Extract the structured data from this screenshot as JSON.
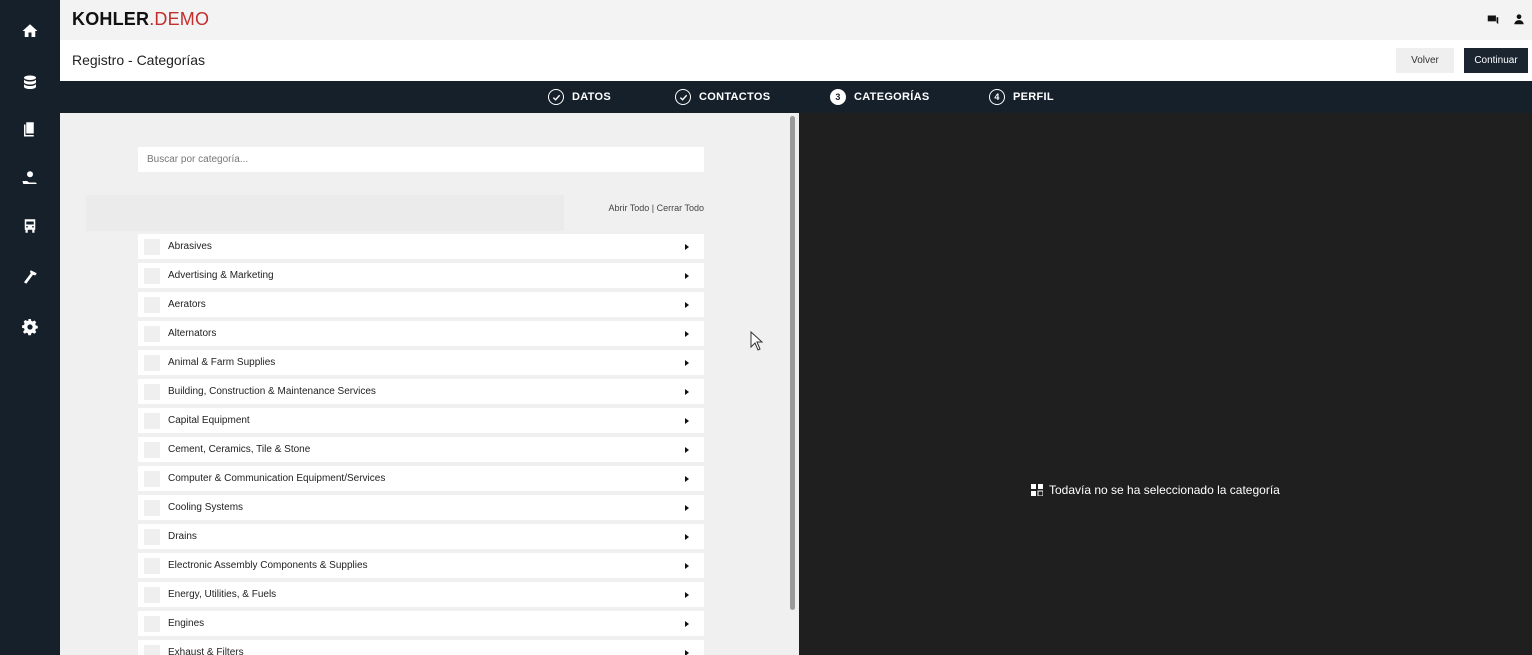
{
  "brand": {
    "name": "KOHLER",
    "suffix": ".DEMO"
  },
  "page": {
    "title": "Registro - Categorías"
  },
  "actions": {
    "back_label": "Volver",
    "continue_label": "Continuar"
  },
  "steps": [
    {
      "label": "DATOS",
      "state": "done"
    },
    {
      "label": "CONTACTOS",
      "state": "done"
    },
    {
      "number": "3",
      "label": "CATEGORÍAS",
      "state": "current"
    },
    {
      "number": "4",
      "label": "PERFIL",
      "state": "pending"
    }
  ],
  "search": {
    "placeholder": "Buscar por categoría..."
  },
  "tree_controls": {
    "open_all": "Abrir Todo",
    "separator": " | ",
    "close_all": "Cerrar Todo"
  },
  "categories": [
    "Abrasives",
    "Advertising & Marketing",
    "Aerators",
    "Alternators",
    "Animal & Farm Supplies",
    "Building, Construction & Maintenance Services",
    "Capital Equipment",
    "Cement, Ceramics, Tile & Stone",
    "Computer & Communication Equipment/Services",
    "Cooling Systems",
    "Drains",
    "Electronic Assembly Components & Supplies",
    "Energy, Utilities, & Fuels",
    "Engines",
    "Exhaust & Filters"
  ],
  "detail": {
    "empty_message": "Todavía no se ha seleccionado la categoría"
  },
  "sidenav": {
    "icons": [
      "home-icon",
      "database-icon",
      "documents-icon",
      "hand-help-icon",
      "bus-icon",
      "hammer-icon",
      "gear-icon"
    ]
  },
  "colors": {
    "nav_bg": "#16202b",
    "brand_red": "#c0302f",
    "detail_bg": "#1f1f1f"
  }
}
